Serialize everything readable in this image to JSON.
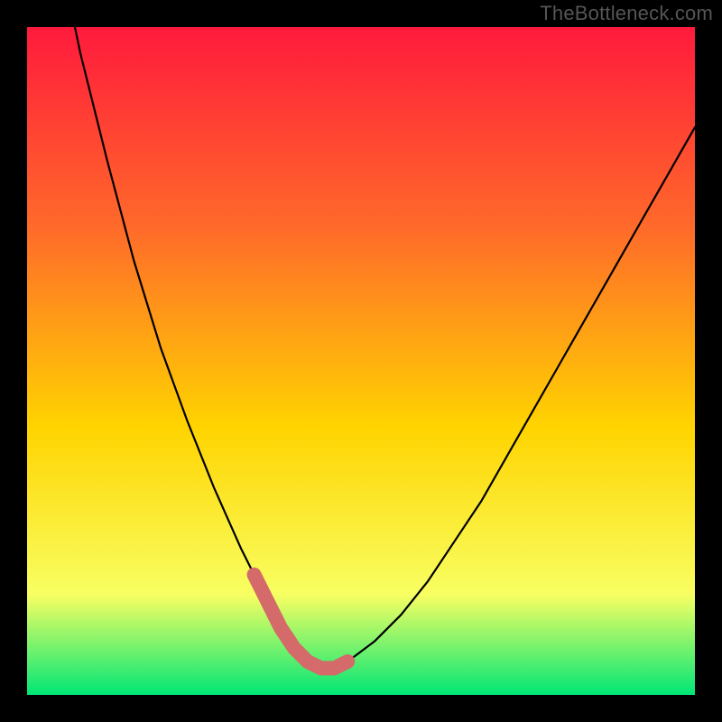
{
  "watermark": "TheBottleneck.com",
  "colors": {
    "background": "#000000",
    "gradient_top": "#ff1a3c",
    "gradient_upper_mid": "#ff6a2a",
    "gradient_mid": "#ffd400",
    "gradient_lower_mid": "#f8ff62",
    "gradient_bottom": "#00e676",
    "curve_main": "#000000",
    "curve_highlight": "#d46a6a"
  },
  "chart_data": {
    "type": "line",
    "title": "",
    "xlabel": "",
    "ylabel": "",
    "xlim": [
      0,
      100
    ],
    "ylim": [
      0,
      100
    ],
    "grid": false,
    "legend": false,
    "series": [
      {
        "name": "bottleneck-curve",
        "x": [
          0,
          4,
          8,
          12,
          16,
          20,
          24,
          28,
          32,
          34,
          36,
          38,
          40,
          42,
          44,
          46,
          48,
          52,
          56,
          60,
          64,
          68,
          72,
          76,
          80,
          84,
          88,
          92,
          96,
          100
        ],
        "y": [
          137,
          115,
          96,
          80,
          65,
          52,
          41,
          31,
          22,
          18,
          14,
          10,
          7,
          5,
          4,
          4,
          5,
          8,
          12,
          17,
          23,
          29,
          36,
          43,
          50,
          57,
          64,
          71,
          78,
          85
        ]
      },
      {
        "name": "highlight-region",
        "x": [
          34,
          36,
          38,
          40,
          42,
          44,
          46,
          48
        ],
        "y": [
          18,
          14,
          10,
          7,
          5,
          4,
          4,
          5
        ]
      }
    ]
  }
}
